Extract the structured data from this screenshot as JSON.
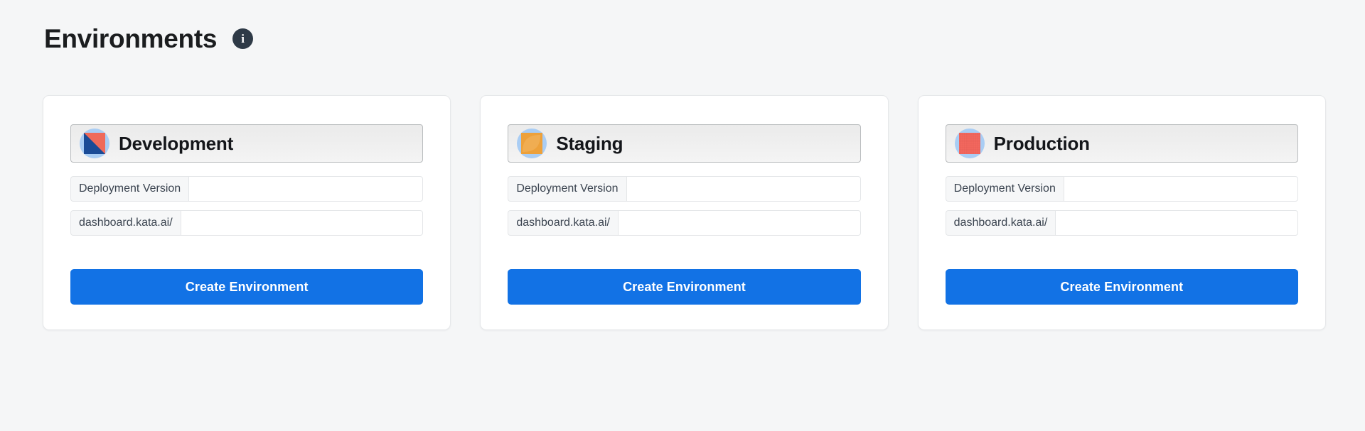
{
  "header": {
    "title": "Environments",
    "info_icon": "info-icon",
    "info_glyph": "i"
  },
  "theme": {
    "page_bg": "#f5f6f7",
    "card_bg": "#ffffff",
    "card_border": "#e6e8ea",
    "primary": "#1272e5",
    "title_color": "#1b1d1f",
    "info_badge_bg": "#2e3a47",
    "avatar_bg": "#a9cdf4",
    "dev_icon_colors": [
      "#1a4b96",
      "#ef6a5a"
    ],
    "staging_icon_color": "#eda13b",
    "production_icon_color": "#f2675e"
  },
  "cards": [
    {
      "name": "Development",
      "icon": "development-env-icon",
      "fields": [
        {
          "addon": "Deployment Version",
          "value": "",
          "placeholder": ""
        },
        {
          "addon": "dashboard.kata.ai/",
          "value": "",
          "placeholder": ""
        }
      ],
      "button_label": "Create Environment"
    },
    {
      "name": "Staging",
      "icon": "staging-env-icon",
      "fields": [
        {
          "addon": "Deployment Version",
          "value": "",
          "placeholder": ""
        },
        {
          "addon": "dashboard.kata.ai/",
          "value": "",
          "placeholder": ""
        }
      ],
      "button_label": "Create Environment"
    },
    {
      "name": "Production",
      "icon": "production-env-icon",
      "fields": [
        {
          "addon": "Deployment Version",
          "value": "",
          "placeholder": ""
        },
        {
          "addon": "dashboard.kata.ai/",
          "value": "",
          "placeholder": ""
        }
      ],
      "button_label": "Create Environment"
    }
  ]
}
